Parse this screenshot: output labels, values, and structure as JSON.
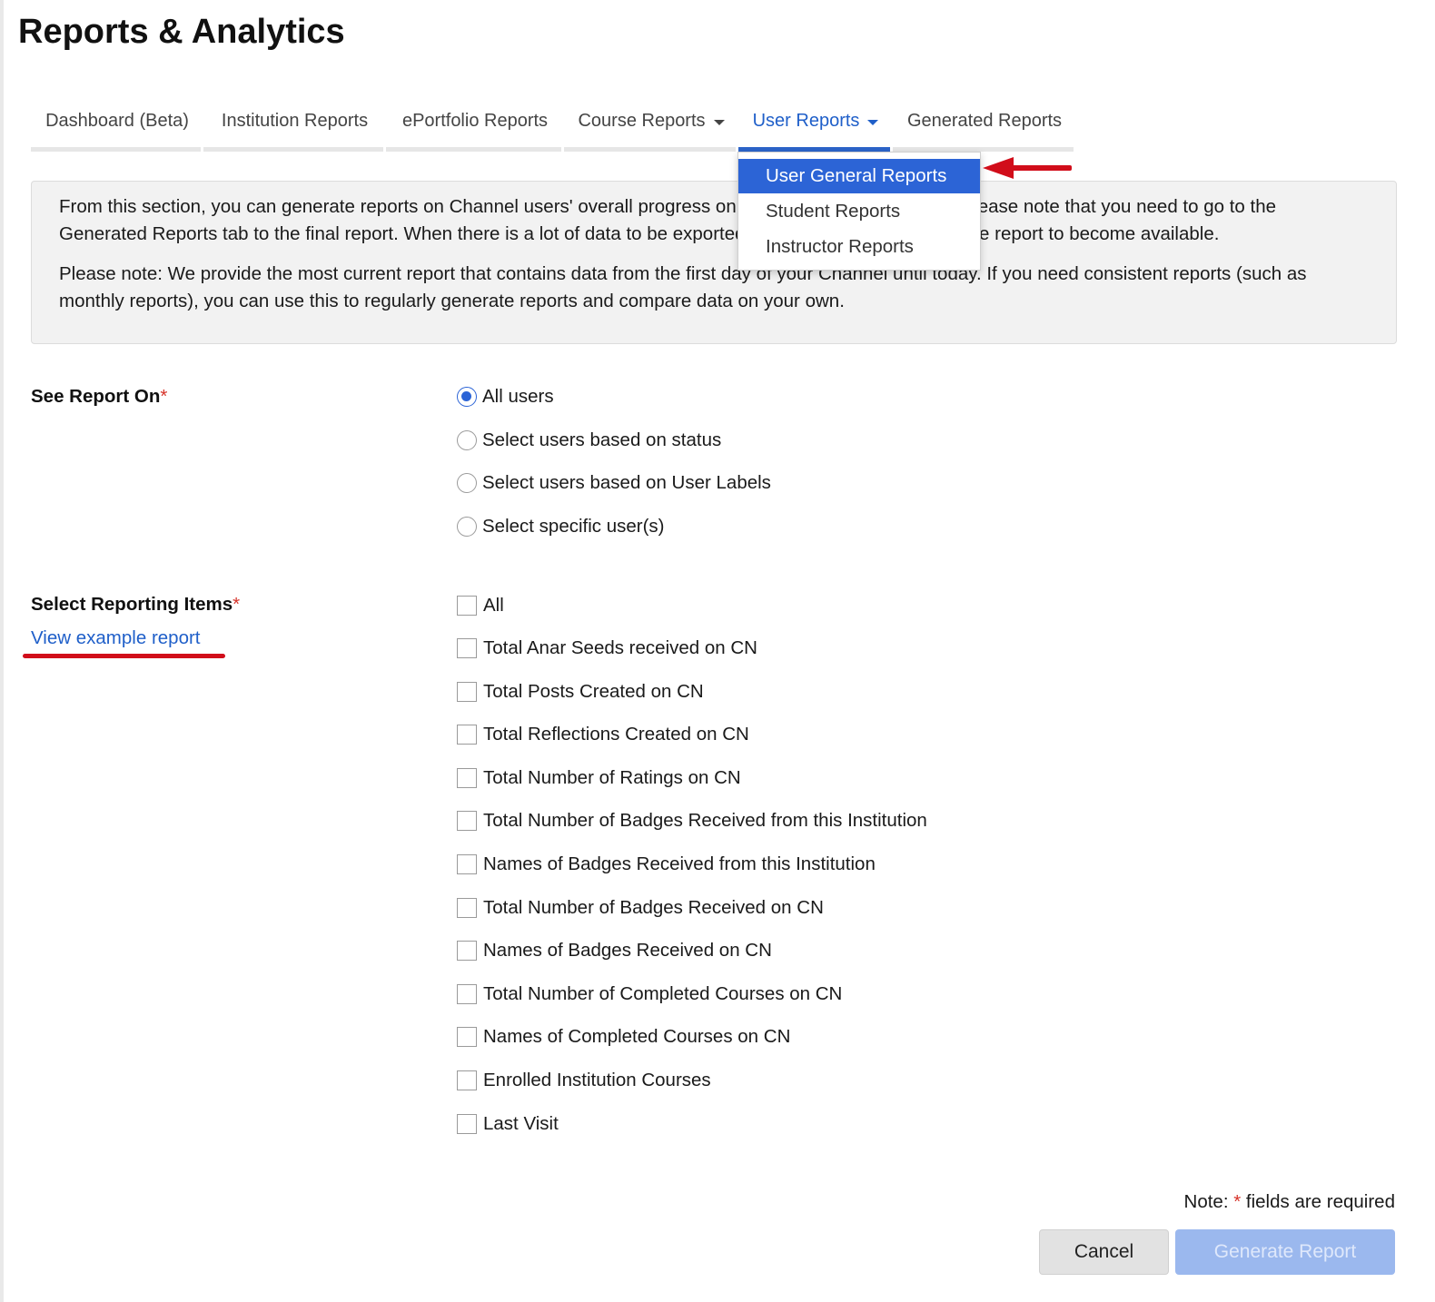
{
  "page": {
    "title": "Reports & Analytics"
  },
  "tabs": [
    {
      "label": "Dashboard (Beta)",
      "has_caret": false,
      "active": false
    },
    {
      "label": "Institution Reports",
      "has_caret": false,
      "active": false
    },
    {
      "label": "ePortfolio Reports",
      "has_caret": false,
      "active": false
    },
    {
      "label": "Course Reports",
      "has_caret": true,
      "active": false
    },
    {
      "label": "User Reports",
      "has_caret": true,
      "active": true
    },
    {
      "label": "Generated Reports",
      "has_caret": false,
      "active": false
    }
  ],
  "dropdown": {
    "items": [
      {
        "label": "User General Reports",
        "selected": true
      },
      {
        "label": "Student Reports",
        "selected": false
      },
      {
        "label": "Instructor Reports",
        "selected": false
      }
    ]
  },
  "info": {
    "p1": "From this section, you can generate reports on Channel users' overall progress on your Channel's education. Please note that you need to go to the Generated Reports tab to the final report. When there is a lot of data to be exported, you may need to wait for the report to become available.",
    "p2": "Please note: We provide the most current report that contains data from the first day of your Channel until today. If you need consistent reports (such as monthly reports), you can use this to regularly generate reports and compare data on your own."
  },
  "see_report_on": {
    "label": "See Report On",
    "required_mark": "*",
    "options": [
      {
        "label": "All users",
        "checked": true
      },
      {
        "label": "Select users based on status",
        "checked": false
      },
      {
        "label": "Select users based on User Labels",
        "checked": false
      },
      {
        "label": "Select specific user(s)",
        "checked": false
      }
    ]
  },
  "reporting_items": {
    "label": "Select Reporting Items",
    "required_mark": "*",
    "link_text": "View example report",
    "items": [
      "All",
      "Total Anar Seeds received on CN",
      "Total Posts Created on CN",
      "Total Reflections Created on CN",
      "Total Number of Ratings on CN",
      "Total Number of Badges Received from this Institution",
      "Names of Badges Received from this Institution",
      "Total Number of Badges Received on CN",
      "Names of Badges Received on CN",
      "Total Number of Completed Courses on CN",
      "Names of Completed Courses on CN",
      "Enrolled Institution Courses",
      "Last Visit"
    ]
  },
  "footer": {
    "note_prefix": "Note: ",
    "note_mark": "*",
    "note_suffix": " fields are required",
    "cancel_label": "Cancel",
    "generate_label": "Generate Report"
  },
  "colors": {
    "accent": "#2c64d6",
    "required": "#d6332a",
    "annotation": "#d10d1a"
  },
  "icons": {
    "caret": "caret-down-icon",
    "arrow": "red-arrow-annotation"
  }
}
